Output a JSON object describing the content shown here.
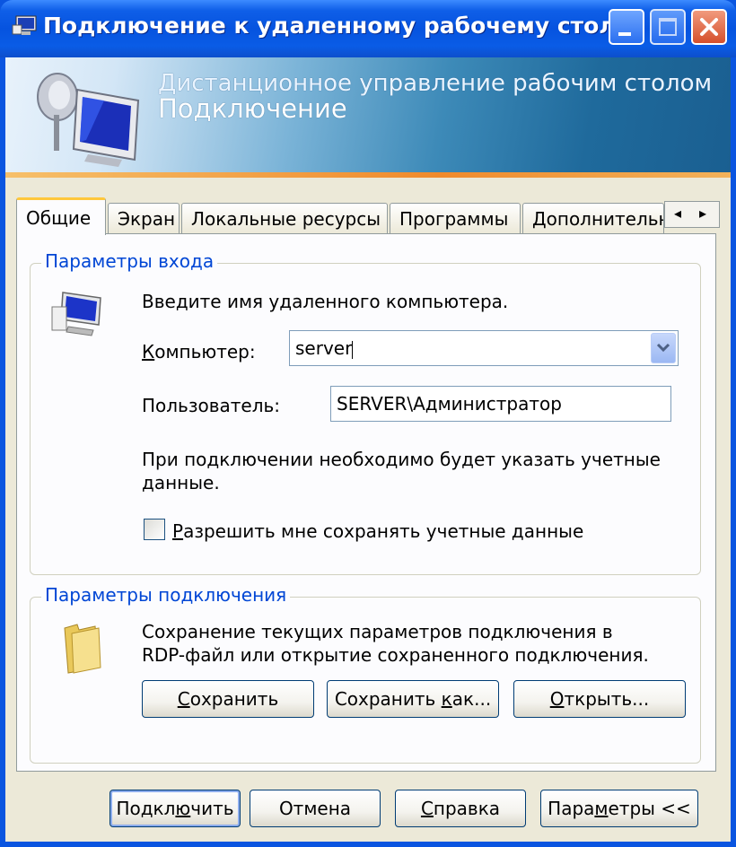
{
  "window": {
    "title": "Подключение к удаленному рабочему столу"
  },
  "banner": {
    "subtitle": "Дистанционное управление рабочим столом",
    "title": "Подключение"
  },
  "tabs": [
    {
      "label": "Общие"
    },
    {
      "label": "Экран"
    },
    {
      "label": "Локальные ресурсы"
    },
    {
      "label": "Программы"
    },
    {
      "label": "Дополнительно"
    }
  ],
  "login_group": {
    "legend": "Параметры входа",
    "instruction": "Введите имя удаленного компьютера.",
    "computer_label_prefix": "К",
    "computer_label_rest": "омпьютер:",
    "computer_value": "server",
    "user_label": "Пользователь:",
    "user_value": "SERVER\\Администратор",
    "note_line1": "При подключении необходимо будет указать учетные",
    "note_line2": "данные.",
    "save_creds_prefix": "Р",
    "save_creds_rest": "азрешить мне сохранять учетные данные"
  },
  "conn_group": {
    "legend": "Параметры подключения",
    "desc_line1": "Сохранение текущих параметров подключения в",
    "desc_line2": "RDP-файл или открытие сохраненного подключения.",
    "save": {
      "u": "С",
      "rest": "охранить"
    },
    "save_as": {
      "pre": "Сохранить ",
      "u": "к",
      "rest": "ак..."
    },
    "open": {
      "u": "О",
      "rest": "ткрыть..."
    }
  },
  "buttons": {
    "connect": {
      "pre": "Подкл",
      "u": "ю",
      "rest": "чить"
    },
    "cancel": "Отмена",
    "help": {
      "u": "С",
      "rest": "правка"
    },
    "params": {
      "pre": "Пара",
      "u": "м",
      "rest": "етры <<"
    }
  },
  "colors": {
    "accent": "#0046d5",
    "title_bar": "#0653df",
    "dialog_bg": "#ece9d8"
  }
}
